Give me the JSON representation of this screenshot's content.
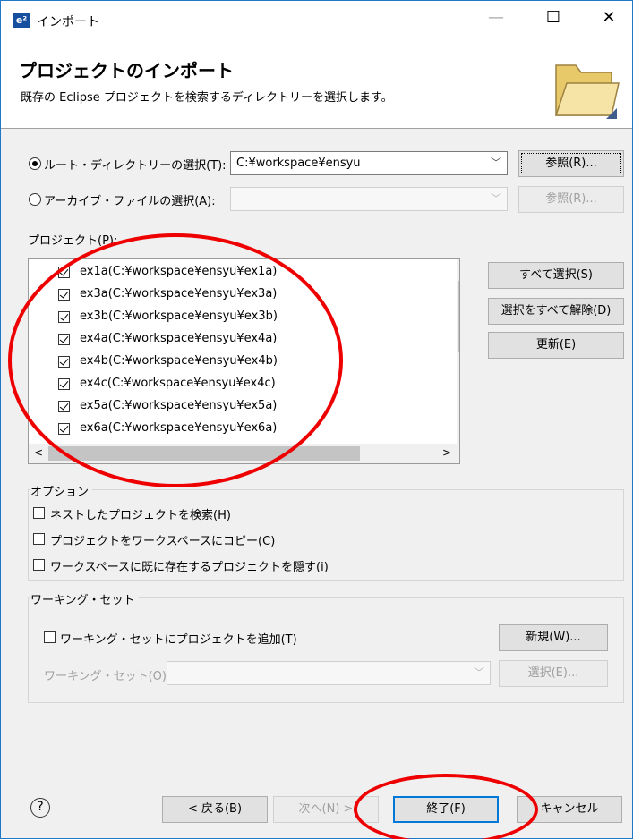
{
  "window": {
    "logo": "e²",
    "title": "インポート",
    "min_icon": "minimize-icon",
    "max_icon": "maximize-icon",
    "close_icon": "close-icon"
  },
  "header": {
    "title": "プロジェクトのインポート",
    "description": "既存の Eclipse プロジェクトを検索するディレクトリーを選択します。"
  },
  "source": {
    "root_label": "ルート・ディレクトリーの選択(T):",
    "root_value": "C:¥workspace¥ensyu",
    "root_browse": "参照(R)...",
    "archive_label": "アーカイブ・ファイルの選択(A):",
    "archive_value": "",
    "archive_browse": "参照(R)..."
  },
  "projects": {
    "label": "プロジェクト(P):",
    "items": [
      {
        "name": "ex1a(C:¥workspace¥ensyu¥ex1a)",
        "checked": true
      },
      {
        "name": "ex3a(C:¥workspace¥ensyu¥ex3a)",
        "checked": true
      },
      {
        "name": "ex3b(C:¥workspace¥ensyu¥ex3b)",
        "checked": true
      },
      {
        "name": "ex4a(C:¥workspace¥ensyu¥ex4a)",
        "checked": true
      },
      {
        "name": "ex4b(C:¥workspace¥ensyu¥ex4b)",
        "checked": true
      },
      {
        "name": "ex4c(C:¥workspace¥ensyu¥ex4c)",
        "checked": true
      },
      {
        "name": "ex5a(C:¥workspace¥ensyu¥ex5a)",
        "checked": true
      },
      {
        "name": "ex6a(C:¥workspace¥ensyu¥ex6a)",
        "checked": true
      }
    ],
    "select_all": "すべて選択(S)",
    "deselect_all": "選択をすべて解除(D)",
    "refresh": "更新(E)"
  },
  "options": {
    "label": "オプション",
    "search_nested": "ネストしたプロジェクトを検索(H)",
    "copy_to_workspace": "プロジェクトをワークスペースにコピー(C)",
    "hide_existing": "ワークスペースに既に存在するプロジェクトを隠す(i)"
  },
  "working_set": {
    "label": "ワーキング・セット",
    "add_label": "ワーキング・セットにプロジェクトを追加(T)",
    "new_button": "新規(W)...",
    "set_label": "ワーキング・セット(O):",
    "select_button": "選択(E)..."
  },
  "footer": {
    "help": "?",
    "back": "< 戻る(B)",
    "next": "次へ(N) >",
    "finish": "終了(F)",
    "cancel": "キャンセル"
  },
  "colors": {
    "accent": "#0078d7",
    "annotation": "#ee0000"
  }
}
